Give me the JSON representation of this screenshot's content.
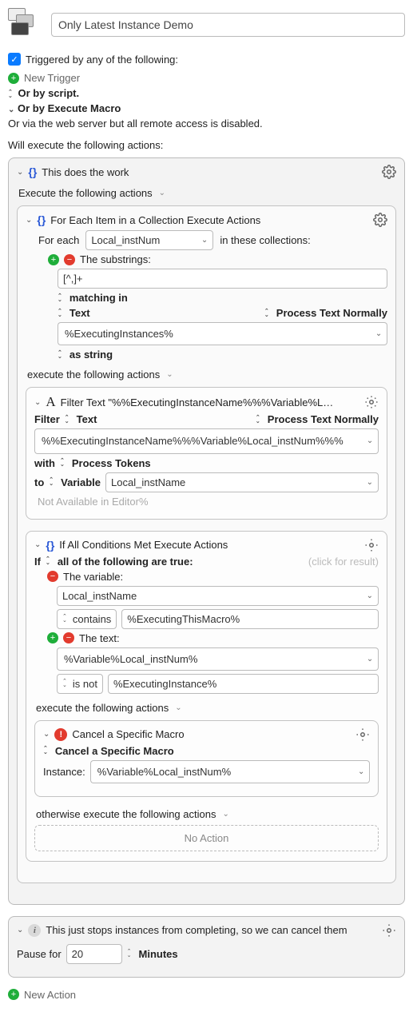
{
  "title": "Only Latest Instance Demo",
  "triggered_label": "Triggered by any of the following:",
  "new_trigger": "New Trigger",
  "or_script": "Or by script.",
  "or_exec_macro": "Or by Execute Macro",
  "or_web": "Or via the web server but all remote access is disabled.",
  "will_exec": "Will execute the following actions:",
  "group1": {
    "title": "This does the work",
    "exec_label": "Execute the following actions",
    "foreach": {
      "title": "For Each Item in a Collection Execute Actions",
      "for_each_label": "For each",
      "for_each_var": "Local_instNum",
      "in_collections": "in these collections:",
      "substrings_label": "The substrings:",
      "substrings_value": "[^,]+",
      "matching_in": "matching in",
      "text_label": "Text",
      "process_normally": "Process Text Normally",
      "source_value": "%ExecutingInstances%",
      "as_string": "as string",
      "exec_label": "execute the following actions",
      "filter": {
        "title": "Filter Text \"%%ExecutingInstanceName%%%Variable%L…",
        "filter_label": "Filter",
        "text_label": "Text",
        "process_normally": "Process Text Normally",
        "body": "%%ExecutingInstanceName%%%Variable%Local_instNum%%%",
        "with_label": "with",
        "with_value": "Process Tokens",
        "to_label": "to",
        "to_type": "Variable",
        "to_var": "Local_instName",
        "not_avail": "Not Available in Editor%"
      },
      "ifblock": {
        "title": "If All Conditions Met Execute Actions",
        "if_label": "If",
        "if_mode": "all of the following are true:",
        "click_result": "(click for result)",
        "var_label": "The variable:",
        "var_name": "Local_instName",
        "contains": "contains",
        "contains_val": "%ExecutingThisMacro%",
        "text_label": "The text:",
        "text_val": "%Variable%Local_instNum%",
        "is_not": "is not",
        "is_not_val": "%ExecutingInstance%",
        "exec_label": "execute the following actions",
        "cancel": {
          "title": "Cancel a Specific Macro",
          "mode": "Cancel a Specific Macro",
          "instance_label": "Instance:",
          "instance_val": "%Variable%Local_instNum%"
        },
        "otherwise": "otherwise execute the following actions",
        "no_action": "No Action"
      }
    }
  },
  "group2": {
    "title": "This just stops instances from completing, so we can cancel them",
    "pause_label": "Pause for",
    "pause_value": "20",
    "pause_unit": "Minutes"
  },
  "new_action": "New Action"
}
